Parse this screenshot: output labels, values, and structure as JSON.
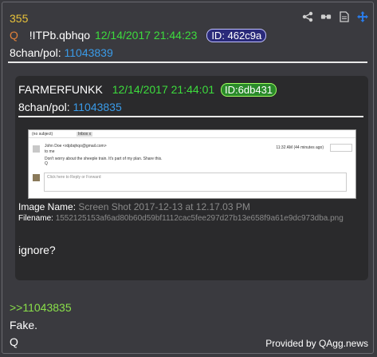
{
  "post": {
    "number": "355",
    "name": "Q",
    "tripcode": "!ITPb.qbhqo",
    "date": "12/14/2017 21:44:23",
    "id": "ID: 462c9a",
    "board_prefix": "8chan/pol:",
    "board_num": "11043839"
  },
  "toolbar": {
    "share_icon": "share-icon",
    "glasses_icon": "glasses-icon",
    "document_icon": "document-icon",
    "move_icon": "move-icon"
  },
  "quote": {
    "name": "FARMERFUNKK",
    "date": "12/14/2017 21:44:01",
    "id": "ID:6db431",
    "board_prefix": "8chan/pol:",
    "board_num": "11043835",
    "image": {
      "subject": "(no subject)",
      "inbox": "Inbox x",
      "sender": "John Doe <rdpbqhqo@gmail.com>",
      "to": "to me",
      "line1": "Don't worry about the sheeple train. It's part of my plan. Share this.",
      "line2": "Q",
      "time": "11:32 AM (44 minutes ago)",
      "reply": "Click here to Reply or Forward"
    },
    "image_name_label": "Image Name:",
    "image_name": "Screen Shot 2017-12-13 at 12.17.03 PM",
    "filename_label": "Filename:",
    "filename": "1552125153af6ad80b60d59bf1112cac5fee297d27b13e658f9a61e9dc973dba.png",
    "body": "ignore?"
  },
  "reply_link": ">>11043835",
  "body_lines": [
    "Fake.",
    "Q"
  ],
  "credit": "Provided by QAgg.news",
  "colors": {
    "background": "#3a3a3f",
    "number": "#e8c23a",
    "name": "#e0803a",
    "date": "#3ddc3d",
    "link": "#3a9be8",
    "greentext": "#8ae04a"
  }
}
